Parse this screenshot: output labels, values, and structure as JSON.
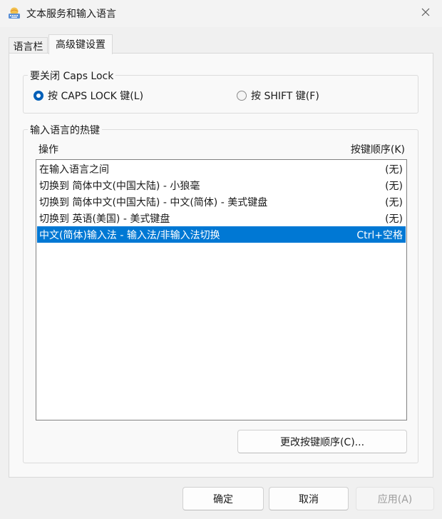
{
  "window": {
    "title": "文本服务和输入语言"
  },
  "tabs": [
    {
      "label": "语言栏",
      "active": false
    },
    {
      "label": "高级键设置",
      "active": true
    }
  ],
  "caps_lock": {
    "legend": "要关闭 Caps Lock",
    "options": [
      {
        "label": "按 CAPS LOCK 键(L)",
        "selected": true
      },
      {
        "label": "按 SHIFT 键(F)",
        "selected": false
      }
    ]
  },
  "hotkeys": {
    "legend": "输入语言的热键",
    "columns": {
      "action": "操作",
      "key": "按键顺序(K)"
    },
    "rows": [
      {
        "action": "在输入语言之间",
        "key": "(无)",
        "selected": false
      },
      {
        "action": "切换到 简体中文(中国大陆) - 小狼毫",
        "key": "(无)",
        "selected": false
      },
      {
        "action": "切换到 简体中文(中国大陆) - 中文(简体) - 美式键盘",
        "key": "(无)",
        "selected": false
      },
      {
        "action": "切换到 英语(美国) - 美式键盘",
        "key": "(无)",
        "selected": false
      },
      {
        "action": "中文(简体)输入法 - 输入法/非输入法切换",
        "key": "Ctrl+空格",
        "selected": true
      }
    ],
    "change_button": "更改按键顺序(C)..."
  },
  "footer": {
    "ok": "确定",
    "cancel": "取消",
    "apply": "应用(A)",
    "apply_enabled": false
  },
  "colors": {
    "selection": "#0078d4",
    "radio_accent": "#005fb8"
  },
  "icons": {
    "app": "keyboard-globe-icon",
    "close": "close-icon"
  }
}
